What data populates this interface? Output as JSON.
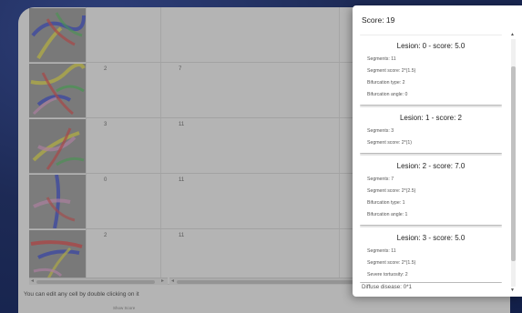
{
  "grid": {
    "rows": [
      {
        "a": "",
        "b": ""
      },
      {
        "a": "2",
        "b": "7"
      },
      {
        "a": "3",
        "b": "11"
      },
      {
        "a": "0",
        "b": "11"
      },
      {
        "a": "2",
        "b": "11"
      }
    ],
    "edit_hint": "You can edit any cell by double clicking on it",
    "footer_link": "Show Score"
  },
  "panel": {
    "title": "Score: 19",
    "lesions": [
      {
        "title": "Lesion: 0 - score: 5.0",
        "lines": [
          "Segments: 11",
          "Segment score: 2*(1.5)",
          "Bifurcation type: 2",
          "Bifurcation angle: 0"
        ]
      },
      {
        "title": "Lesion: 1 - score: 2",
        "lines": [
          "Segments: 3",
          "Segment score: 2*(1)"
        ]
      },
      {
        "title": "Lesion: 2 - score: 7.0",
        "lines": [
          "Segments: 7",
          "Segment score: 2*(2.5)",
          "Bifurcation type: 1",
          "Bifurcation angle: 1"
        ]
      },
      {
        "title": "Lesion: 3 - score: 5.0",
        "lines": [
          "Segments: 11",
          "Segment score: 2*(1.5)",
          "Severe tortuosity: 2"
        ]
      }
    ],
    "diffuse": "Diffuse disease: 0*1"
  },
  "colors": {
    "background": "#1c2a52",
    "panel": "#ffffff",
    "overlay": "rgba(90,90,90,0.42)"
  }
}
